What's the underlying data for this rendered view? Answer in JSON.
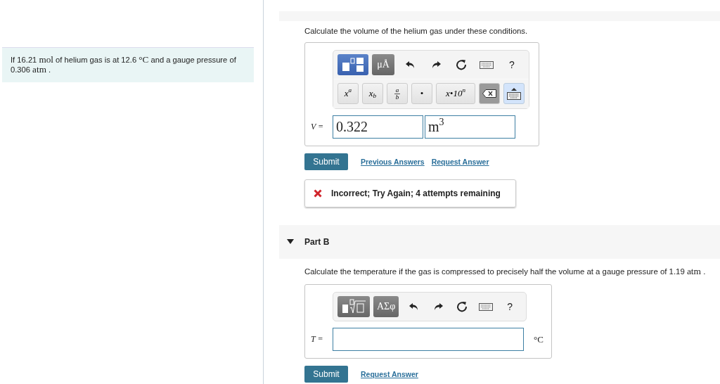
{
  "problem": {
    "segments": [
      {
        "kind": "plain",
        "text": "If 16.21 "
      },
      {
        "kind": "math",
        "text": "mol"
      },
      {
        "kind": "plain",
        "text": " of helium gas is at 12.6 "
      },
      {
        "kind": "math",
        "text": "°C"
      },
      {
        "kind": "plain",
        "text": " and a gauge pressure of "
      },
      {
        "kind": "plain",
        "text": "0.306 "
      },
      {
        "kind": "math",
        "text": "atm"
      },
      {
        "kind": "plain",
        "text": " ."
      }
    ]
  },
  "parts": [
    {
      "prompt": [
        {
          "kind": "plain",
          "text": "Calculate the volume of the helium gas under these conditions."
        }
      ],
      "toolbar": [
        {
          "kind": "template",
          "selected": true
        },
        {
          "kind": "label",
          "label": "μÅ",
          "selected": false
        },
        {
          "kind": "undo"
        },
        {
          "kind": "redo"
        },
        {
          "kind": "reset"
        },
        {
          "kind": "keyboard"
        },
        {
          "kind": "help",
          "label": "?"
        }
      ],
      "keypad": [
        {
          "kind": "sup",
          "base": "x",
          "mark": "a"
        },
        {
          "kind": "sub",
          "base": "x",
          "mark": "b"
        },
        {
          "kind": "fraction",
          "top": "a",
          "bottom": "b"
        },
        {
          "kind": "plainkey",
          "label": "•"
        },
        {
          "kind": "widekey",
          "base": "x•10",
          "mark": "n"
        },
        {
          "kind": "backspace"
        },
        {
          "kind": "keyboard-toggle",
          "on": true
        }
      ],
      "variable": "V =",
      "value": "0.322",
      "unit": {
        "kind": "field",
        "text": "m",
        "power": "3"
      },
      "submit": "Submit",
      "links": [
        "Previous Answers",
        "Request Answer"
      ],
      "feedback": {
        "kind": "incorrect",
        "text": "Incorrect; Try Again; 4 attempts remaining"
      }
    },
    {
      "header": {
        "title": "Part B",
        "expanded": true
      },
      "prompt": [
        {
          "kind": "plain",
          "text": "Calculate the temperature if the gas is compressed to precisely half the volume at a gauge pressure of 1.19 "
        },
        {
          "kind": "math",
          "text": "atm"
        },
        {
          "kind": "plain",
          "text": " ."
        }
      ],
      "toolbar": [
        {
          "kind": "sqrt-template",
          "selected": false
        },
        {
          "kind": "label",
          "label": "ΑΣφ",
          "selected": false
        },
        {
          "kind": "undo"
        },
        {
          "kind": "redo"
        },
        {
          "kind": "reset"
        },
        {
          "kind": "keyboard"
        },
        {
          "kind": "help",
          "label": "?"
        }
      ],
      "variable": "T =",
      "unit": {
        "kind": "text",
        "text": "°C"
      },
      "submit": "Submit",
      "links": [
        "Request Answer"
      ]
    }
  ]
}
